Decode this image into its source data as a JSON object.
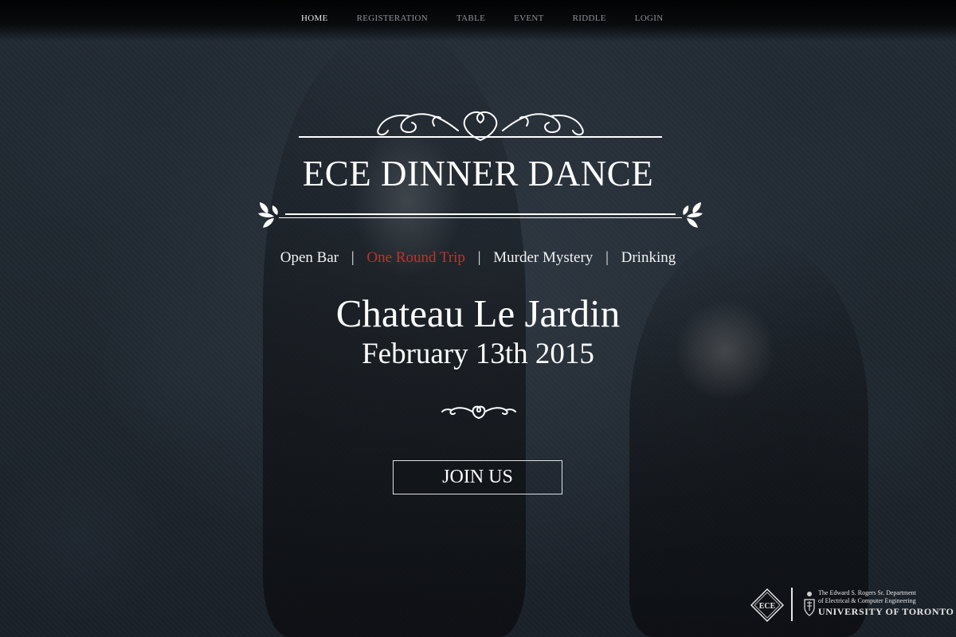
{
  "nav": {
    "items": [
      {
        "label": "HOME",
        "active": true
      },
      {
        "label": "REGISTERATION",
        "active": false
      },
      {
        "label": "TABLE",
        "active": false
      },
      {
        "label": "EVENT",
        "active": false
      },
      {
        "label": "RIDDLE",
        "active": false
      },
      {
        "label": "LOGIN",
        "active": false
      }
    ]
  },
  "hero": {
    "title": "ECE DINNER DANCE",
    "features": [
      "Open Bar",
      "One Round Trip",
      "Murder Mystery",
      "Drinking"
    ],
    "separator": "|",
    "venue": "Chateau Le Jardin",
    "date": "February 13th 2015",
    "cta_label": "JOIN US"
  },
  "footer": {
    "ece_logo_text": "ECE",
    "dept_line1": "The Edward S. Rogers Sr. Department",
    "dept_line2": "of Electrical & Computer Engineering",
    "university": "UNIVERSITY OF TORONTO"
  },
  "colors": {
    "background": "#1d242c",
    "accent_red": "#c4302b",
    "text": "#ffffff",
    "nav_inactive": "#8d9299"
  }
}
